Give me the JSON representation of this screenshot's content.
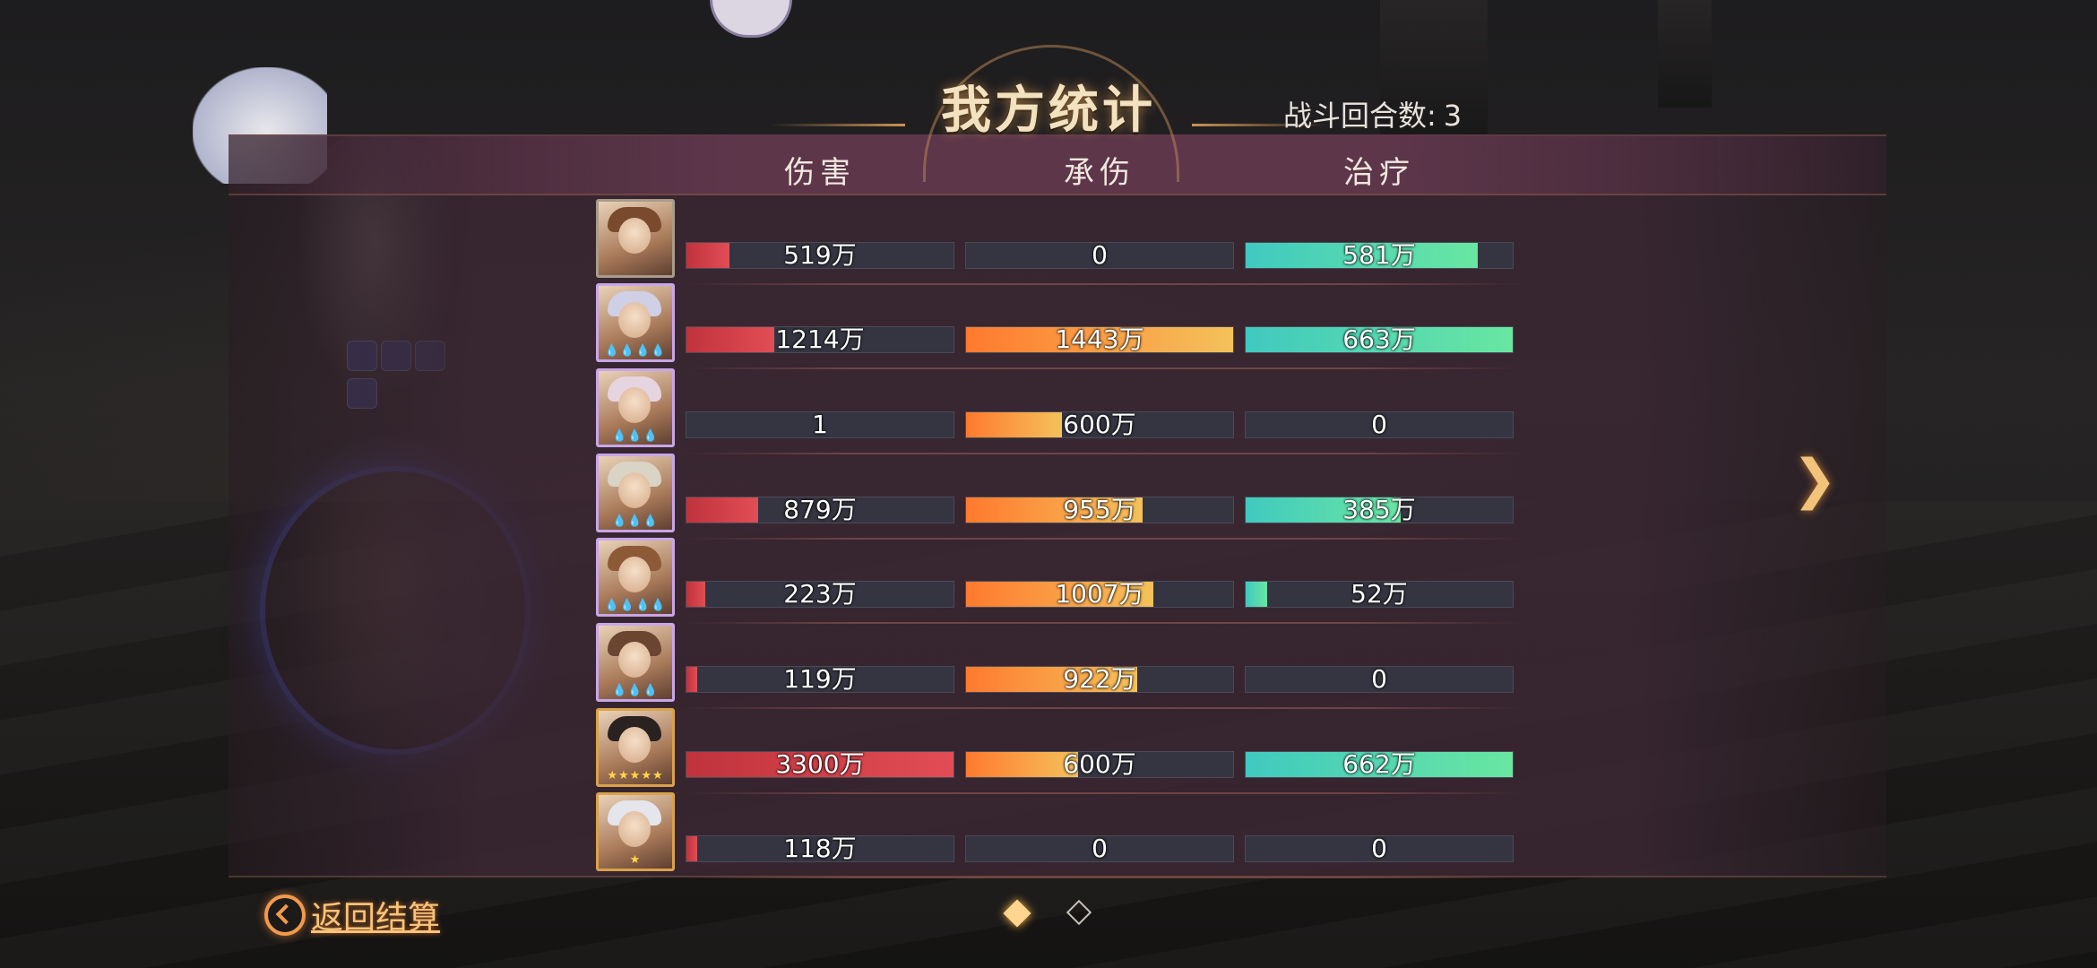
{
  "title": "我方统计",
  "round_info": {
    "label": "战斗回合数:",
    "value": "3"
  },
  "columns": [
    "伤害",
    "承伤",
    "治疗"
  ],
  "rows": [
    {
      "damage": {
        "label": "519万",
        "frac": 0.16
      },
      "taken": {
        "label": "0",
        "frac": 0
      },
      "heal": {
        "label": "581万",
        "frac": 0.87
      },
      "frame": "plain",
      "stars": ""
    },
    {
      "damage": {
        "label": "1214万",
        "frac": 0.33
      },
      "taken": {
        "label": "1443万",
        "frac": 1.0
      },
      "heal": {
        "label": "663万",
        "frac": 1.0
      },
      "frame": "purple",
      "stars": "💧💧💧💧"
    },
    {
      "damage": {
        "label": "1",
        "frac": 0
      },
      "taken": {
        "label": "600万",
        "frac": 0.36
      },
      "heal": {
        "label": "0",
        "frac": 0
      },
      "frame": "purple",
      "stars": "💧💧💧"
    },
    {
      "damage": {
        "label": "879万",
        "frac": 0.27
      },
      "taken": {
        "label": "955万",
        "frac": 0.66
      },
      "heal": {
        "label": "385万",
        "frac": 0.58
      },
      "frame": "purple",
      "stars": "💧💧💧"
    },
    {
      "damage": {
        "label": "223万",
        "frac": 0.07
      },
      "taken": {
        "label": "1007万",
        "frac": 0.7
      },
      "heal": {
        "label": "52万",
        "frac": 0.08
      },
      "frame": "purple",
      "stars": "💧💧💧💧"
    },
    {
      "damage": {
        "label": "119万",
        "frac": 0.04
      },
      "taken": {
        "label": "922万",
        "frac": 0.64
      },
      "heal": {
        "label": "0",
        "frac": 0
      },
      "frame": "purple",
      "stars": "💧💧💧"
    },
    {
      "damage": {
        "label": "3300万",
        "frac": 1.0
      },
      "taken": {
        "label": "600万",
        "frac": 0.42
      },
      "heal": {
        "label": "662万",
        "frac": 1.0
      },
      "frame": "gold",
      "stars": "★★★★★"
    },
    {
      "damage": {
        "label": "118万",
        "frac": 0.04
      },
      "taken": {
        "label": "0",
        "frac": 0
      },
      "heal": {
        "label": "0",
        "frac": 0
      },
      "frame": "gold",
      "stars": "★"
    }
  ],
  "back_button": "返回结算",
  "next_icon": "next-arrow-icon",
  "pagination": {
    "pages": 2,
    "current": 1
  },
  "colors": {
    "damage": "#e24d55",
    "taken": "#ff7a2e",
    "heal": "#40c9c0",
    "accent": "#f6c37a"
  }
}
